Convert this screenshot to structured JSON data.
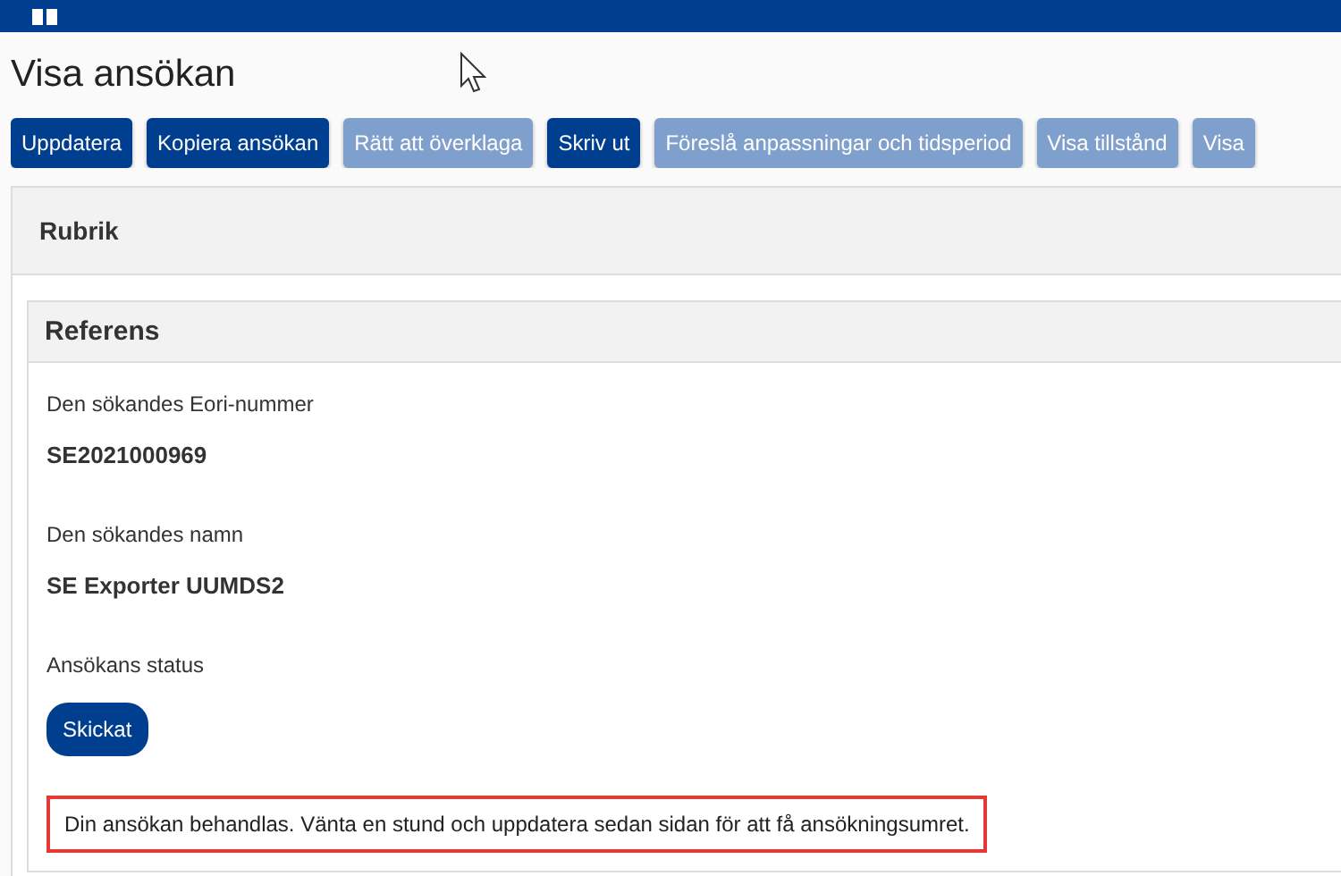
{
  "page": {
    "title": "Visa ansökan"
  },
  "actions": [
    {
      "label": "Uppdatera",
      "disabled": false
    },
    {
      "label": "Kopiera ansökan",
      "disabled": false
    },
    {
      "label": "Rätt att överklaga",
      "disabled": true
    },
    {
      "label": "Skriv ut",
      "disabled": false
    },
    {
      "label": "Föreslå anpassningar och tidsperiod",
      "disabled": true
    },
    {
      "label": "Visa tillstånd",
      "disabled": true
    },
    {
      "label": "Visa",
      "disabled": true
    }
  ],
  "panel": {
    "title": "Rubrik",
    "section": {
      "title": "Referens",
      "fields": [
        {
          "kind": "text",
          "label": "Den sökandes Eori-nummer",
          "value": "SE2021000969"
        },
        {
          "kind": "text",
          "label": "Den sökandes namn",
          "value": "SE Exporter UUMDS2"
        },
        {
          "kind": "badge",
          "label": "Ansökans status",
          "value": "Skickat"
        }
      ],
      "notice": "Din ansökan behandlas. Vänta en stund och uppdatera sedan sidan för att få ansökningsumret."
    }
  }
}
